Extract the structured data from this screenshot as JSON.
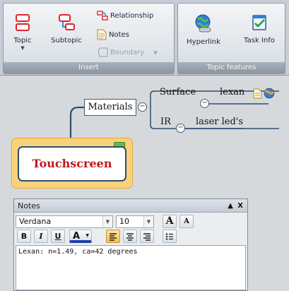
{
  "ribbon": {
    "insert_group": {
      "label": "Insert",
      "topic_label": "Topic",
      "subtopic_label": "Subtopic",
      "relationship_label": "Relationship",
      "notes_label": "Notes",
      "boundary_label": "Boundary"
    },
    "features_group": {
      "label": "Topic features",
      "hyperlink_label": "Hyperlink",
      "taskinfo_label": "Task Info"
    }
  },
  "map": {
    "central_topic": "Touchscreen",
    "main_topic": "Materials",
    "subtopics": [
      {
        "label": "Surface",
        "child": "lexan"
      },
      {
        "label": "IR",
        "child": "laser led's"
      }
    ],
    "collapse_symbol": "−"
  },
  "notes_panel": {
    "title": "Notes",
    "pin_symbol": "▲",
    "close_symbol": "X",
    "font_family_value": "Verdana",
    "font_size_value": "10",
    "grow_font": "A",
    "shrink_font": "A",
    "bold": "B",
    "italic": "I",
    "underline": "U",
    "font_color": "A",
    "content": "Lexan: n=1.49, ca=42 degrees"
  },
  "colors": {
    "central_text": "#c0161c",
    "central_highlight": "#f8d27a",
    "connector": "#2c4f70",
    "ribbon_bg": "#c5cdd6"
  }
}
